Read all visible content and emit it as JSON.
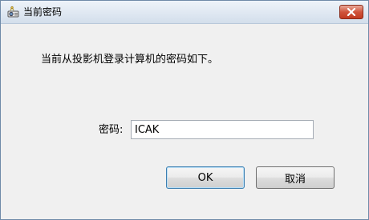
{
  "window": {
    "title": "当前密码",
    "icon": "projector-icon"
  },
  "content": {
    "message": "当前从投影机登录计算机的密码如下。",
    "password_label": "密码:",
    "password_value": "ICAK"
  },
  "buttons": {
    "ok_label": "OK",
    "cancel_label": "取消"
  },
  "colors": {
    "close_button": "#c13a21",
    "titlebar": "#dfe8f2",
    "dialog_background": "#f0f0f0"
  }
}
